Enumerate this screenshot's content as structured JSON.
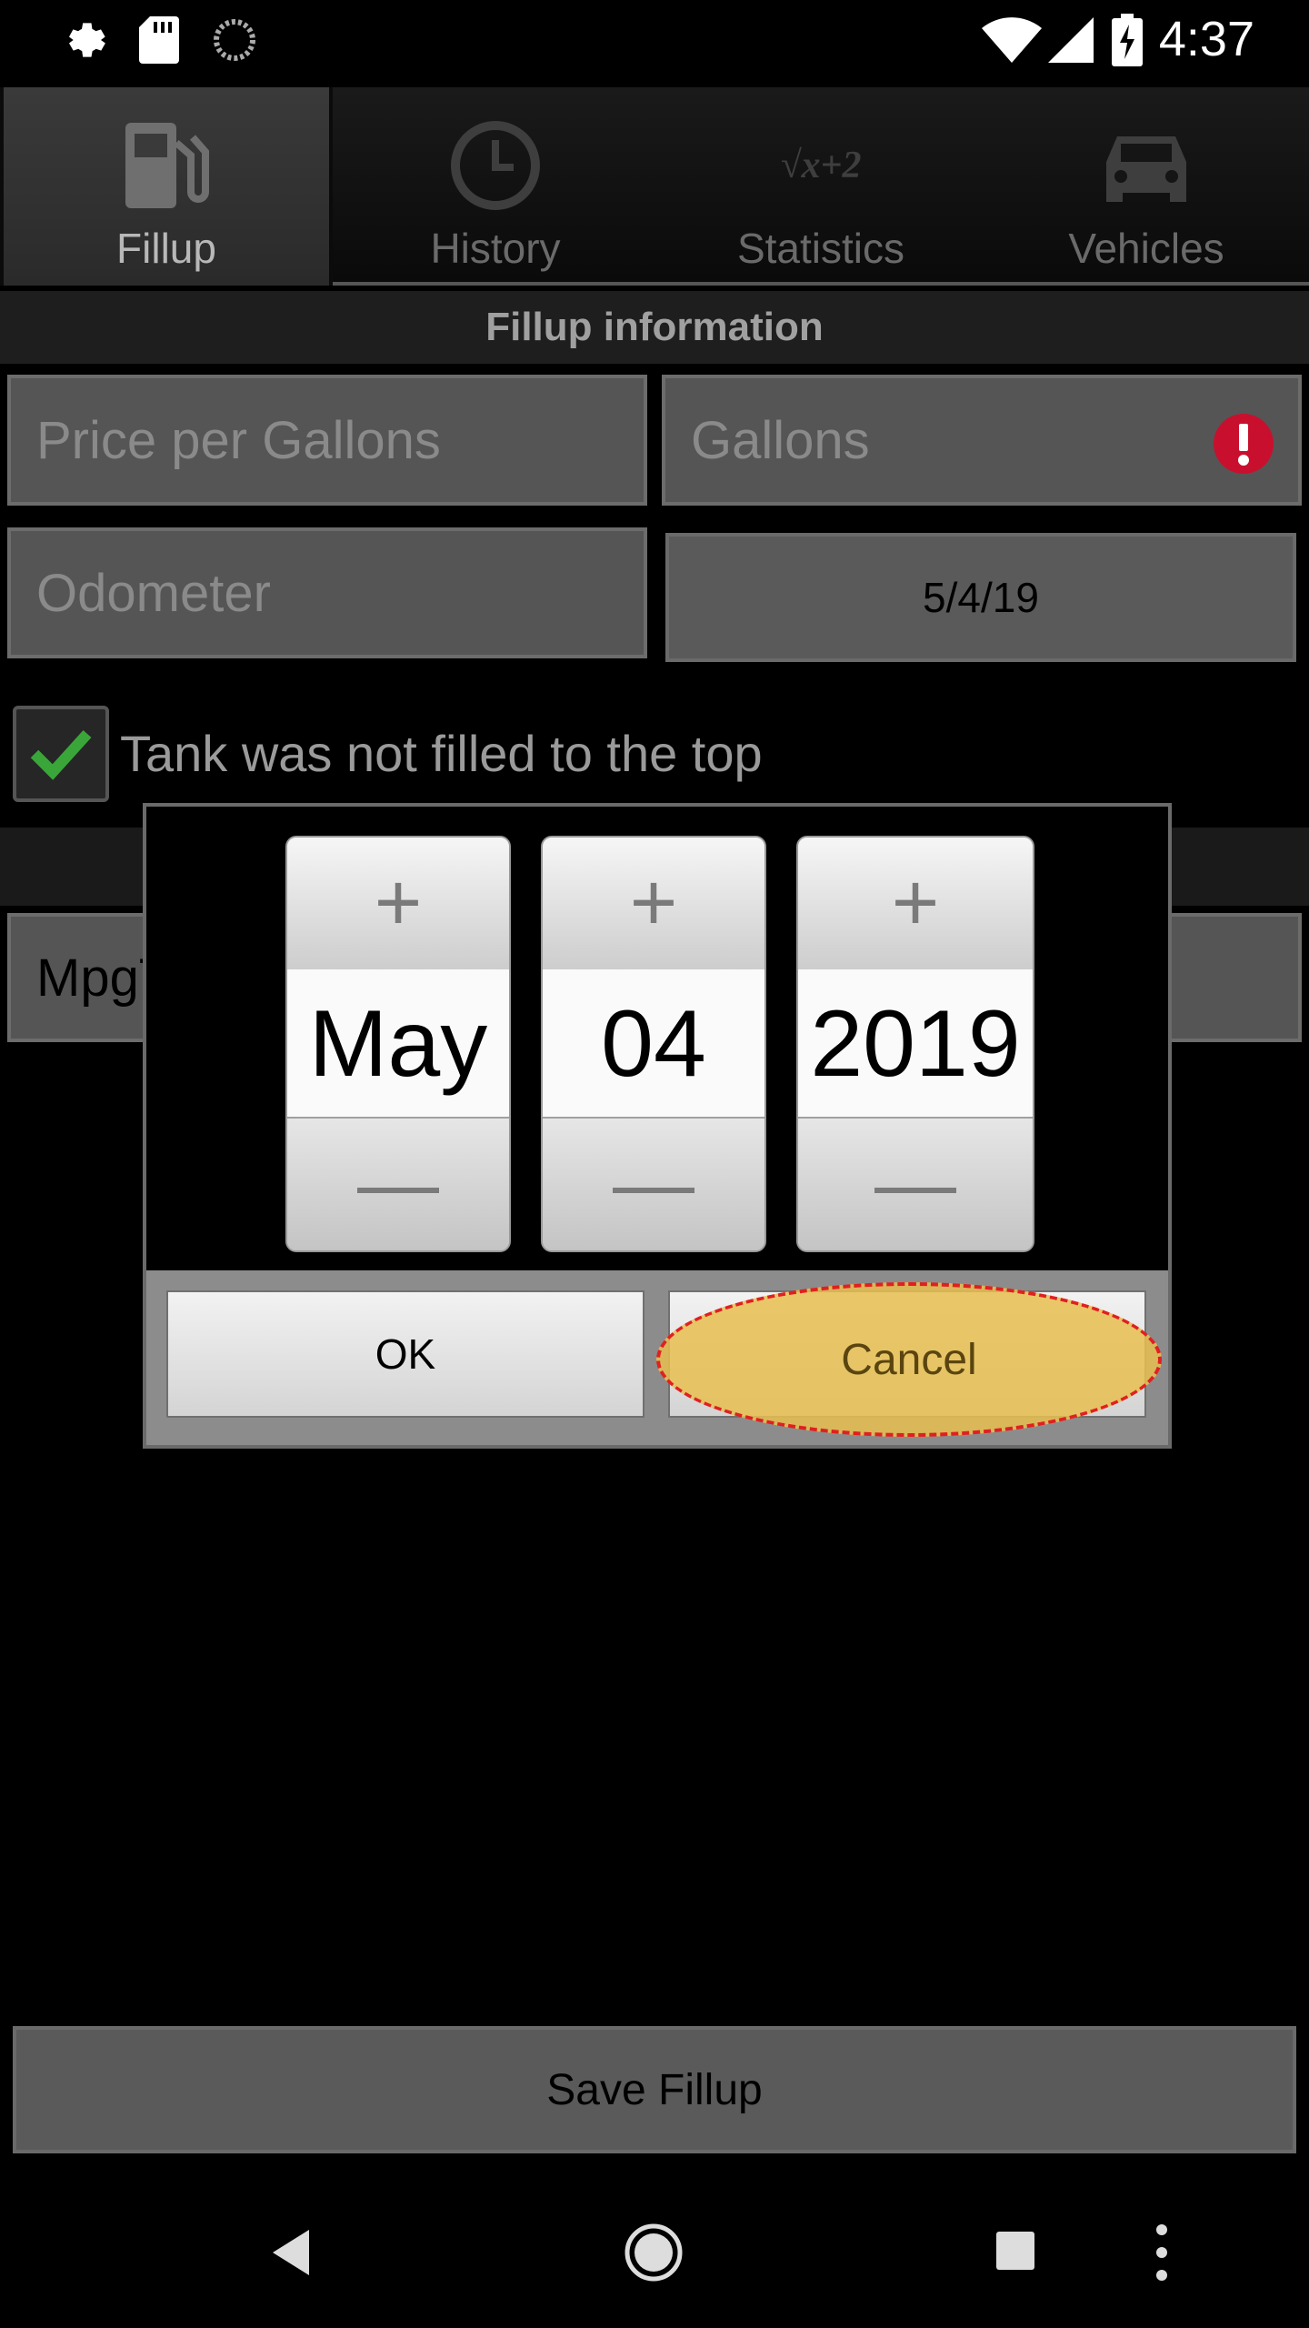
{
  "status_bar": {
    "icons": [
      "gear-icon",
      "sd-card-icon",
      "sync-icon",
      "wifi-icon",
      "signal-icon",
      "battery-charging-icon"
    ],
    "time": "4:37"
  },
  "tabs": [
    {
      "label": "Fillup",
      "icon": "fuel-pump-icon",
      "active": true
    },
    {
      "label": "History",
      "icon": "clock-icon",
      "active": false
    },
    {
      "label": "Statistics",
      "icon": "formula-icon",
      "active": false
    },
    {
      "label": "Vehicles",
      "icon": "car-icon",
      "active": false
    }
  ],
  "formula_glyph": "√x+2",
  "section_title": "Fillup information",
  "fields": {
    "price_placeholder": "Price per Gallons",
    "gallons_placeholder": "Gallons",
    "odometer_placeholder": "Odometer",
    "date_value": "5/4/19",
    "vehicle_value": "MpgTij"
  },
  "checkbox": {
    "label": "Tank was not filled to the top",
    "checked": true
  },
  "date_picker": {
    "month": "May",
    "day": "04",
    "year": "2019",
    "plus_glyph": "+",
    "minus_glyph": "—",
    "ok_label": "OK",
    "cancel_label": "Cancel"
  },
  "save_label": "Save Fillup",
  "colors": {
    "error": "#c8102e",
    "check": "#3aa63a",
    "highlight": "#e8be50"
  }
}
